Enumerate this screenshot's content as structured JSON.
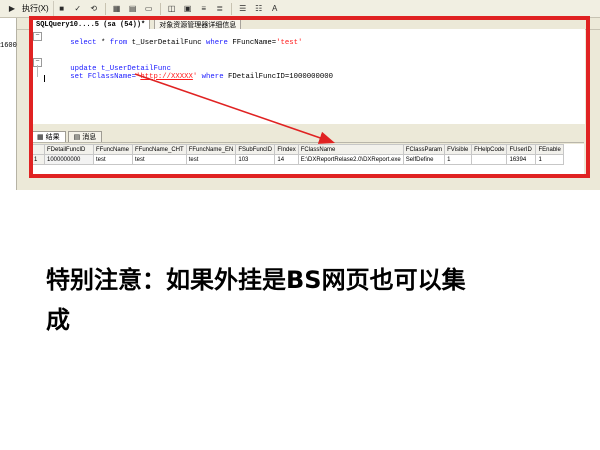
{
  "toolbar": {
    "execute_label": "执行(X)",
    "icons": [
      "play-icon",
      "stop-icon",
      "check-icon",
      "parse-icon",
      "grid-icon",
      "text-icon",
      "file-icon",
      "estimated-plan-icon",
      "query-options-icon",
      "indent-icon",
      "outdent-icon",
      "comment-icon",
      "uncomment-icon",
      "font-icon"
    ]
  },
  "left_strip": {
    "value": "1600"
  },
  "tabs": {
    "active_label": "SQLQuery10....5 (sa (54))*",
    "inactive_label": "对象资源管理器详细信息"
  },
  "editor": {
    "line1": {
      "kw_select": "select",
      "star": " * ",
      "kw_from": "from",
      "table": " t_UserDetailFunc ",
      "kw_where": "where",
      "field": " FFuncName=",
      "str": "'test'"
    },
    "line2": {
      "kw_update": "update",
      "table": " t_UserDetailFunc"
    },
    "line3": {
      "kw_set": "set",
      "field": " FClassName=",
      "quote_open": "'",
      "url": "http://XXXXX",
      "quote_close": "'",
      "kw_where": " where",
      "cond": " FDetailFuncID=1000000000"
    }
  },
  "results_tabs": [
    {
      "label": "结果",
      "icon": "results-grid-icon"
    },
    {
      "label": "消息",
      "icon": "messages-icon"
    }
  ],
  "grid": {
    "columns": [
      "FDetailFuncID",
      "FFuncName",
      "FFuncName_CHT",
      "FFuncName_EN",
      "FSubFuncID",
      "FIndex",
      "FClassName",
      "FClassParam",
      "FVisible",
      "FHelpCode",
      "FUserID",
      "FEnable"
    ],
    "rows": [
      {
        "rownum": "1",
        "cells": [
          "1000000000",
          "test",
          "test",
          "test",
          "103",
          "14",
          "E:\\DXReportRelase2.0\\DXReport.exe",
          "SelfDefine",
          "1",
          "",
          "16394",
          "1"
        ]
      }
    ]
  },
  "annotation": {
    "color": "#e02222"
  },
  "note": {
    "line1": "特别注意：如果外挂是BS网页也可以集",
    "line2": "成"
  }
}
